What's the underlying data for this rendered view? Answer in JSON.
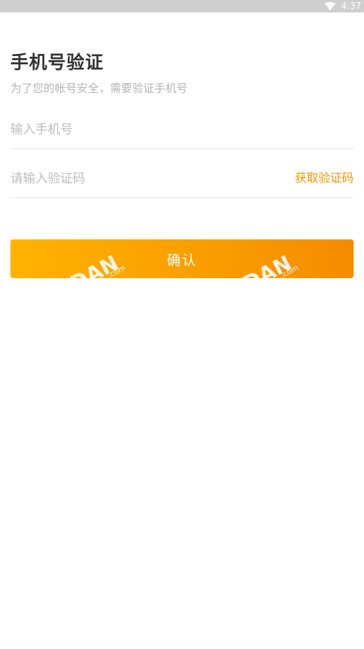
{
  "status_bar": {
    "time": "4:37",
    "icons": [
      "wifi-icon"
    ]
  },
  "page": {
    "title": "手机号验证",
    "subtitle": "为了您的帐号安全，需要验证手机号"
  },
  "form": {
    "phone_placeholder": "输入手机号",
    "code_placeholder": "请输入验证码",
    "get_code_label": "获取验证码",
    "confirm_label": "确认"
  },
  "watermarks": {
    "big": "DAN",
    "small": ".com"
  },
  "colors": {
    "status_bar": "#cfcfcf",
    "accent": "#f19500",
    "button_gradient_start": "#ffb300",
    "button_gradient_end": "#f58c00",
    "title": "#333333",
    "placeholder": "#bdbdbd"
  }
}
